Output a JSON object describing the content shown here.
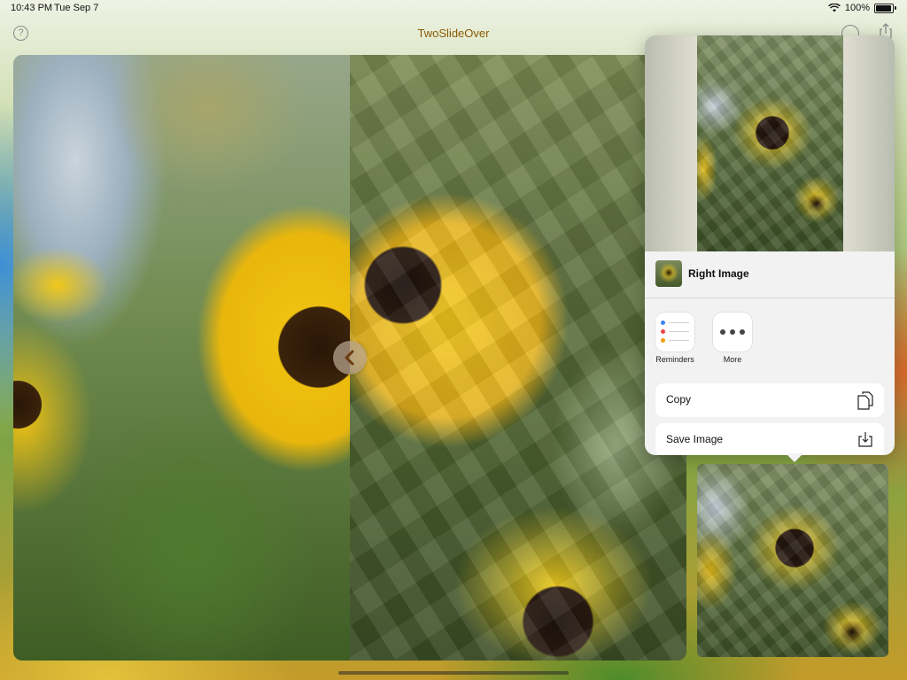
{
  "status_bar": {
    "time": "10:43 PM",
    "date": "Tue Sep 7",
    "battery": "100%"
  },
  "nav_bar": {
    "title": "TwoSlideOver",
    "help_icon": "question-circle-icon",
    "settings_icon": "gear-icon",
    "share_icon": "share-icon"
  },
  "comparison": {
    "handle_icon": "chevron-left-icon"
  },
  "share_sheet": {
    "item_title": "Right Image",
    "apps": [
      {
        "label": "Reminders",
        "icon": "reminders-icon"
      },
      {
        "label": "More",
        "icon": "more-icon"
      }
    ],
    "actions": [
      {
        "label": "Copy",
        "icon": "copy-icon"
      },
      {
        "label": "Save Image",
        "icon": "save-image-icon"
      }
    ]
  },
  "colors": {
    "title": "#8a5a00",
    "reminder_blue": "#3b82f6",
    "reminder_red": "#ef4444",
    "reminder_orange": "#f59e0b"
  }
}
